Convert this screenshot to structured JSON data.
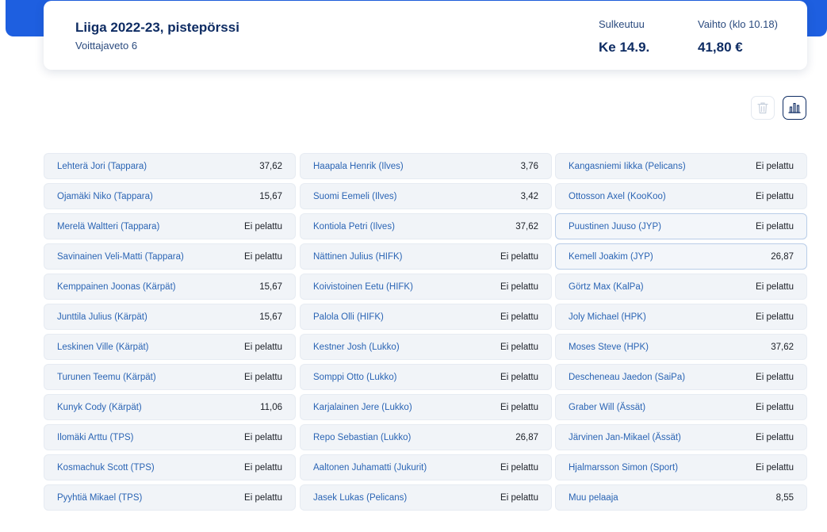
{
  "header": {
    "title": "Liiga 2022-23, pistepörssi",
    "subtitle": "Voittajaveto 6",
    "close_label": "Sulkeutuu",
    "close_value": "Ke 14.9.",
    "exchange_label": "Vaihto (klo 10.18)",
    "exchange_value": "41,80 €"
  },
  "colors": {
    "accent": "#1e5fe0",
    "title": "#0e2c63",
    "player_link": "#2a64b4",
    "cell_bg": "#f1f4f8"
  },
  "toolbar": {
    "delete_icon": "trash-icon",
    "stats_icon": "bar-chart-icon"
  },
  "columns": [
    [
      {
        "name": "Lehterä Jori (Tappara)",
        "value": "37,62"
      },
      {
        "name": "Ojamäki Niko (Tappara)",
        "value": "15,67"
      },
      {
        "name": "Merelä Waltteri (Tappara)",
        "value": "Ei pelattu"
      },
      {
        "name": "Savinainen Veli-Matti (Tappara)",
        "value": "Ei pelattu"
      },
      {
        "name": "Kemppainen Joonas (Kärpät)",
        "value": "15,67"
      },
      {
        "name": "Junttila Julius (Kärpät)",
        "value": "15,67"
      },
      {
        "name": "Leskinen Ville (Kärpät)",
        "value": "Ei pelattu"
      },
      {
        "name": "Turunen Teemu (Kärpät)",
        "value": "Ei pelattu"
      },
      {
        "name": "Kunyk Cody (Kärpät)",
        "value": "11,06"
      },
      {
        "name": "Ilomäki Arttu (TPS)",
        "value": "Ei pelattu"
      },
      {
        "name": "Kosmachuk Scott (TPS)",
        "value": "Ei pelattu"
      },
      {
        "name": "Pyyhtiä Mikael (TPS)",
        "value": "Ei pelattu"
      }
    ],
    [
      {
        "name": "Haapala Henrik (Ilves)",
        "value": "3,76"
      },
      {
        "name": "Suomi Eemeli (Ilves)",
        "value": "3,42"
      },
      {
        "name": "Kontiola Petri (Ilves)",
        "value": "37,62"
      },
      {
        "name": "Nättinen Julius (HIFK)",
        "value": "Ei pelattu"
      },
      {
        "name": "Koivistoinen Eetu (HIFK)",
        "value": "Ei pelattu"
      },
      {
        "name": "Palola Olli (HIFK)",
        "value": "Ei pelattu"
      },
      {
        "name": "Kestner Josh (Lukko)",
        "value": "Ei pelattu"
      },
      {
        "name": "Somppi Otto (Lukko)",
        "value": "Ei pelattu"
      },
      {
        "name": "Karjalainen Jere (Lukko)",
        "value": "Ei pelattu"
      },
      {
        "name": "Repo Sebastian (Lukko)",
        "value": "26,87"
      },
      {
        "name": "Aaltonen Juhamatti (Jukurit)",
        "value": "Ei pelattu"
      },
      {
        "name": "Jasek Lukas (Pelicans)",
        "value": "Ei pelattu"
      }
    ],
    [
      {
        "name": "Kangasniemi Iikka (Pelicans)",
        "value": "Ei pelattu"
      },
      {
        "name": "Ottosson Axel (KooKoo)",
        "value": "Ei pelattu"
      },
      {
        "name": "Puustinen Juuso (JYP)",
        "value": "Ei pelattu",
        "highlighted": true
      },
      {
        "name": "Kemell Joakim (JYP)",
        "value": "26,87",
        "highlighted": true
      },
      {
        "name": "Görtz Max (KalPa)",
        "value": "Ei pelattu"
      },
      {
        "name": "Joly Michael (HPK)",
        "value": "Ei pelattu"
      },
      {
        "name": "Moses Steve (HPK)",
        "value": "37,62"
      },
      {
        "name": "Descheneau Jaedon (SaiPa)",
        "value": "Ei pelattu"
      },
      {
        "name": "Graber Will (Ässät)",
        "value": "Ei pelattu"
      },
      {
        "name": "Järvinen Jan-Mikael (Ässät)",
        "value": "Ei pelattu"
      },
      {
        "name": "Hjalmarsson Simon (Sport)",
        "value": "Ei pelattu"
      },
      {
        "name": "Muu pelaaja",
        "value": "8,55"
      }
    ]
  ]
}
